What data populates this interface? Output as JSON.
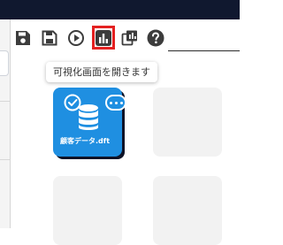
{
  "toolbar": {
    "icons": [
      "save-icon",
      "save-as-icon",
      "run-icon",
      "visualization-icon",
      "copy-icon",
      "help-icon"
    ],
    "highlight_color": "#e42121"
  },
  "tooltip": {
    "text": "可視化画面を開きます"
  },
  "cards": {
    "active": {
      "label": "顧客データ.dft",
      "color": "#1f8fe1"
    }
  },
  "colors": {
    "topbar": "#10182f",
    "icon": "#3c3c3c",
    "empty_card": "#f2f2f2"
  }
}
